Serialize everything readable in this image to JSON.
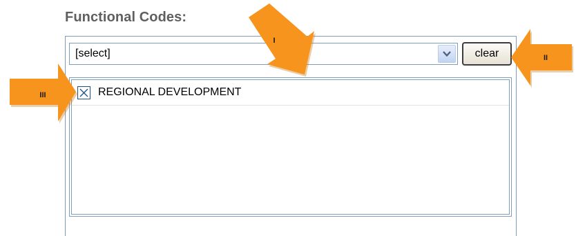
{
  "heading": "Functional Codes:",
  "select": {
    "value": "[select]"
  },
  "clear_button": {
    "label": "clear"
  },
  "list": {
    "items": [
      {
        "label": "REGIONAL DEVELOPMENT",
        "checked": true
      }
    ]
  },
  "annotations": {
    "arrow_1": "I",
    "arrow_2": "II",
    "arrow_3": "III"
  },
  "colors": {
    "arrow_orange": "#f7941d",
    "border_blue": "#7f9db9",
    "heading_gray": "#5f5f5f"
  }
}
